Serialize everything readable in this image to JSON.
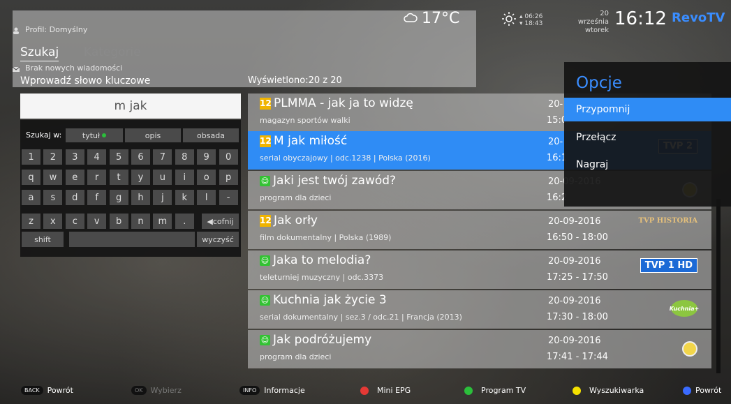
{
  "header": {
    "profile": "Profil: Domyślny",
    "messages": "Brak nowych wiadomości",
    "temperature": "17°C",
    "sunrise": "06:26",
    "sunset": "18:43",
    "date": "20 września",
    "weekday": "wtorek",
    "clock": "16:12",
    "logo": "RevoTV"
  },
  "tabs": {
    "search": "Szukaj",
    "categories": "Kategorie"
  },
  "search": {
    "label": "Wprowadź słowo kluczowe",
    "value": "m jak",
    "filter_label": "Szukaj w:",
    "filters": [
      "tytuł",
      "opis",
      "obsada"
    ],
    "rows": [
      [
        "1",
        "2",
        "3",
        "4",
        "5",
        "6",
        "7",
        "8",
        "9",
        "0"
      ],
      [
        "q",
        "w",
        "e",
        "r",
        "t",
        "y",
        "u",
        "i",
        "o",
        "p"
      ],
      [
        "a",
        "s",
        "d",
        "f",
        "g",
        "h",
        "j",
        "k",
        "l",
        "-"
      ],
      [
        "z",
        "x",
        "c",
        "v",
        "b",
        "n",
        "m",
        "."
      ]
    ],
    "backspace": "cofnij",
    "shift": "shift",
    "clear": "wyczyść"
  },
  "results": {
    "count_label": "Wyświetlono:20 z 20",
    "items": [
      {
        "rating": "12",
        "title": "PLMMA - jak ja to widzę",
        "sub": "magazyn sportów walki",
        "date": "20-",
        "time": "15:0"
      },
      {
        "rating": "12",
        "title": "M jak miłość",
        "sub": "serial obyczajowy | odc.1238 | Polska (2016)",
        "date": "20-",
        "time": "16:1",
        "channel": "TVP 2"
      },
      {
        "rating": "smile",
        "title": "Jaki jest twój zawód?",
        "sub": "program dla dzieci",
        "date": "20-09-2016",
        "time": "16:2"
      },
      {
        "rating": "12",
        "title": "Jak orły",
        "sub": "film dokumentalny | Polska (1989)",
        "date": "20-09-2016",
        "time": "16:50 - 18:00",
        "channel": "TVP HISTORIA"
      },
      {
        "rating": "smile",
        "title": "Jaka to melodia?",
        "sub": "teleturniej muzyczny | odc.3373",
        "date": "20-09-2016",
        "time": "17:25 - 17:50",
        "channel": "TVP 1 HD"
      },
      {
        "rating": "smile",
        "title": "Kuchnia jak życie 3",
        "sub": "serial dokumentalny | sez.3 / odc.21 | Francja (2013)",
        "date": "20-09-2016",
        "time": "17:30 - 18:00",
        "channel": "Kuchnia+"
      },
      {
        "rating": "smile",
        "title": "Jak podróżujemy",
        "sub": "program dla dzieci",
        "date": "20-09-2016",
        "time": "17:41 - 17:44"
      }
    ]
  },
  "options": {
    "title": "Opcje",
    "items": [
      "Przypomnij",
      "Przełącz",
      "Nagraj"
    ]
  },
  "bottom_bar": {
    "back_pill": "BACK",
    "back": "Powrót",
    "ok_pill": "OK",
    "ok": "Wybierz",
    "info_pill": "INFO",
    "info": "Informacje",
    "red": "Mini EPG",
    "green": "Program TV",
    "yellow": "Wyszukiwarka",
    "blue": "Powrót"
  },
  "colors": {
    "accent": "#2f8cf5",
    "red": "#e53935",
    "green": "#2bbf3b",
    "yellow": "#f5e100",
    "blue": "#3a6bff"
  }
}
